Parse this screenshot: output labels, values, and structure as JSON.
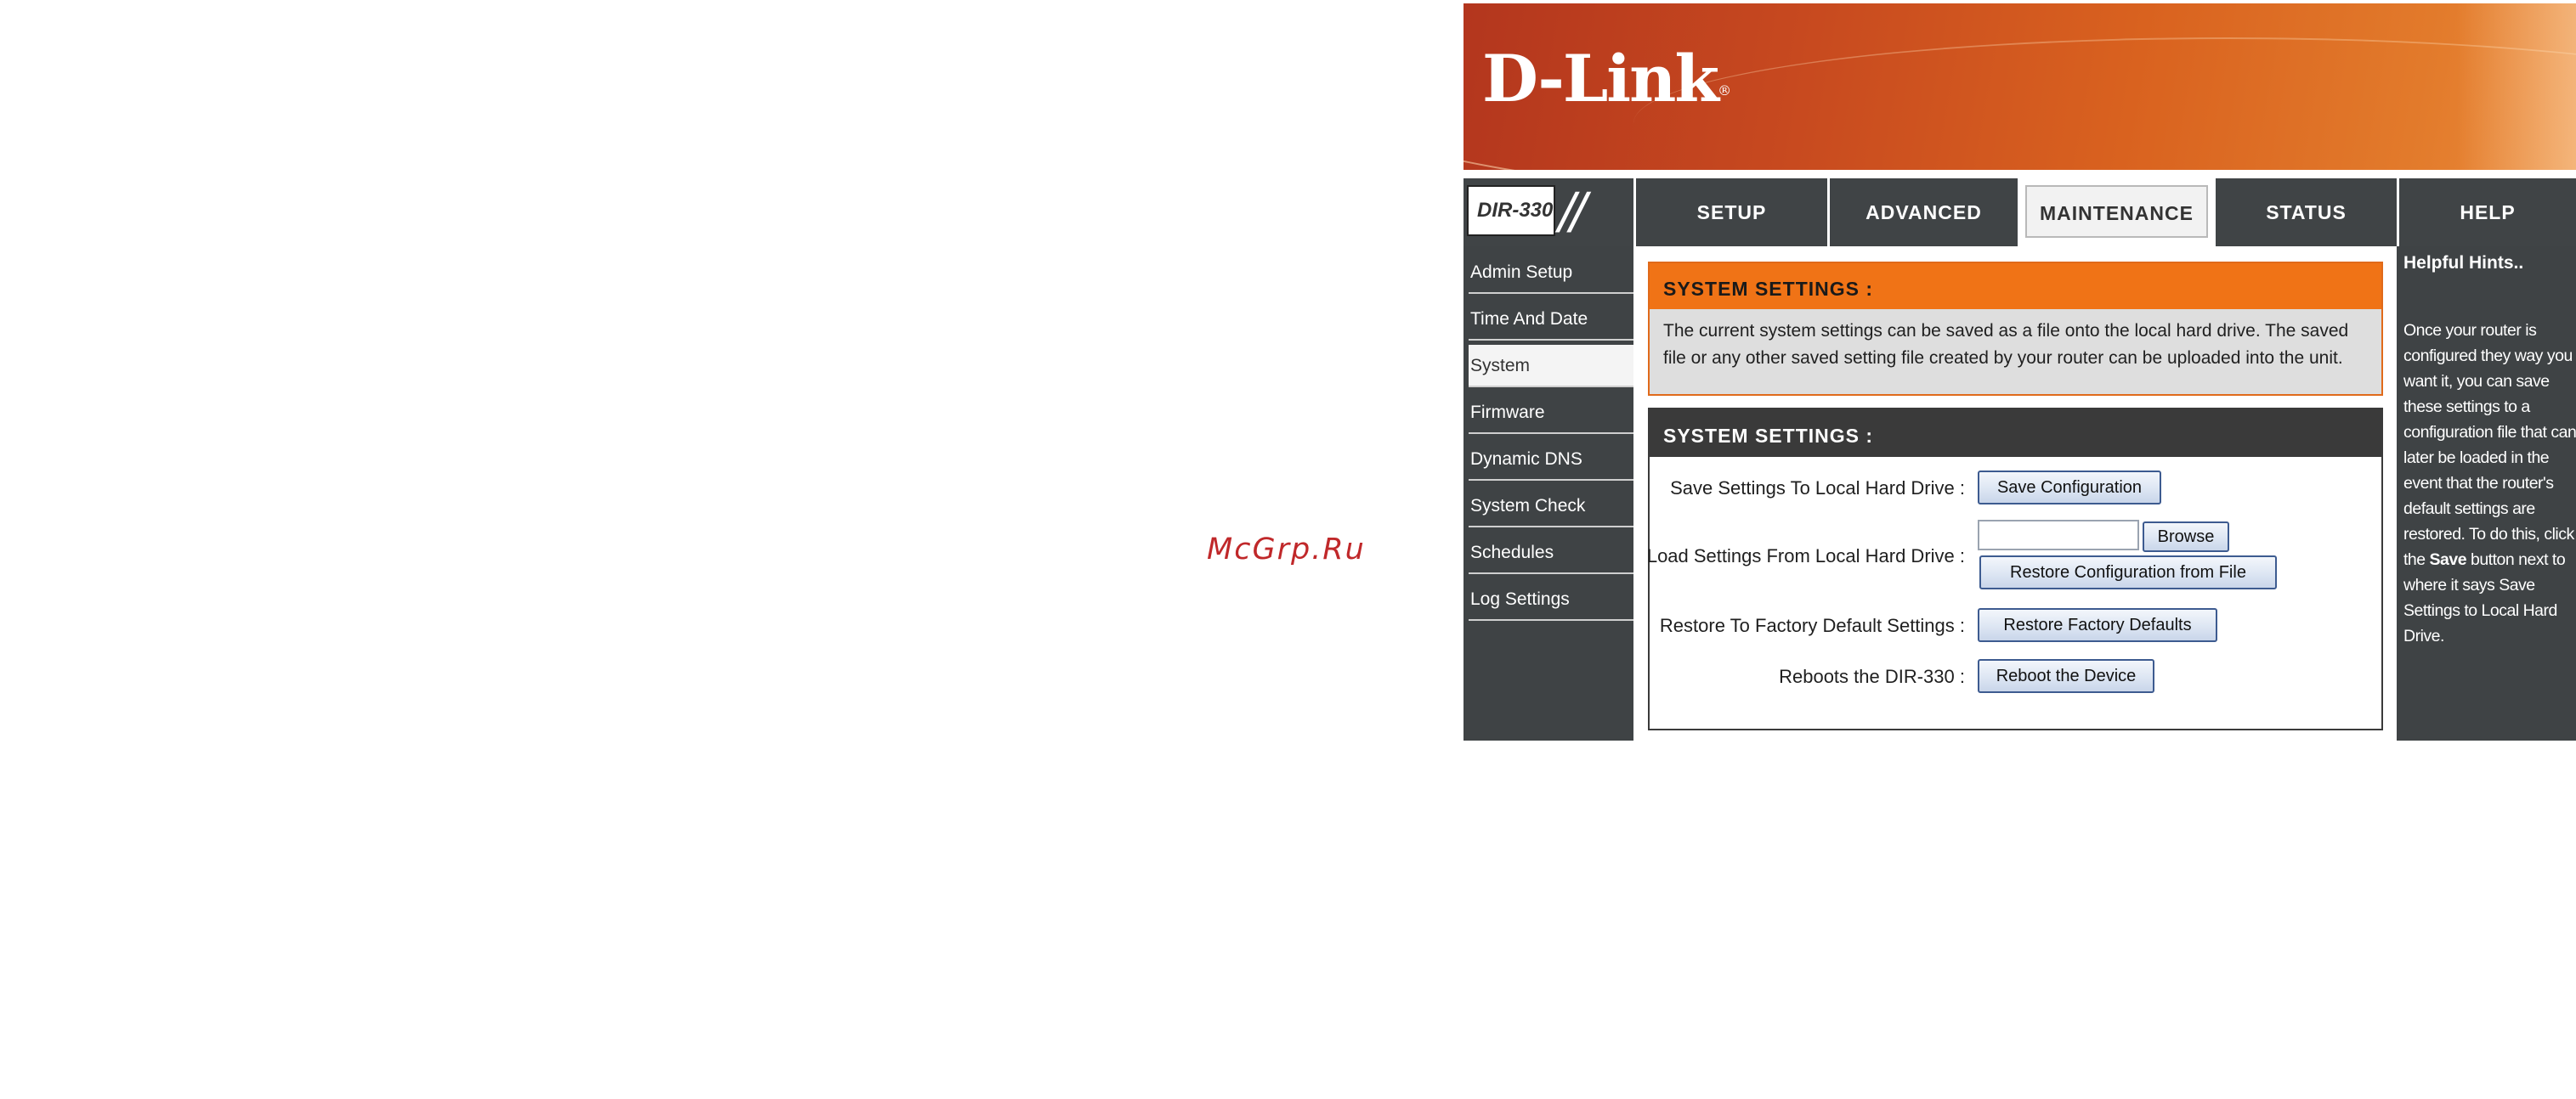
{
  "watermark": "McGrp.Ru",
  "brand": {
    "logo": "D-Link",
    "reg": "®",
    "model": "DIR-330"
  },
  "nav": {
    "tabs": [
      {
        "label": "SETUP"
      },
      {
        "label": "ADVANCED"
      },
      {
        "label": "MAINTENANCE",
        "active": true
      },
      {
        "label": "STATUS"
      },
      {
        "label": "HELP"
      }
    ]
  },
  "sidebar": {
    "items": [
      {
        "label": "Admin Setup"
      },
      {
        "label": "Time And Date"
      },
      {
        "label": "System",
        "active": true
      },
      {
        "label": "Firmware"
      },
      {
        "label": "Dynamic DNS"
      },
      {
        "label": "System Check"
      },
      {
        "label": "Schedules"
      },
      {
        "label": "Log Settings"
      }
    ]
  },
  "intro": {
    "title": "SYSTEM SETTINGS :",
    "text": "The current system settings can be saved as a file onto the local hard drive. The saved file or any other saved setting file created by your router can be uploaded into the unit."
  },
  "settings": {
    "title": "SYSTEM SETTINGS :",
    "save_label": "Save Settings To Local Hard Drive :",
    "save_button": "Save Configuration",
    "load_label": "Load Settings From Local Hard Drive :",
    "browse_button": "Browse",
    "restore_file_button": "Restore Configuration from File",
    "factory_label": "Restore To Factory Default Settings :",
    "factory_button": "Restore Factory Defaults",
    "reboot_label": "Reboots the DIR-330 :",
    "reboot_button": "Reboot the Device",
    "file_value": ""
  },
  "hints": {
    "title": "Helpful Hints..",
    "text_before": "Once your router is configured they way you want it, you can save these settings to a configuration file that can later be loaded in the event that the router's default settings are restored. To do this, click the ",
    "bold": "Save",
    "text_after": " button next to where it says Save Settings to Local Hard Drive."
  },
  "colors": {
    "orange": "#f07316",
    "dark": "#3f4345",
    "banner_start": "#b3361e",
    "banner_end": "#eb8c3a",
    "watermark": "#c0282a"
  }
}
